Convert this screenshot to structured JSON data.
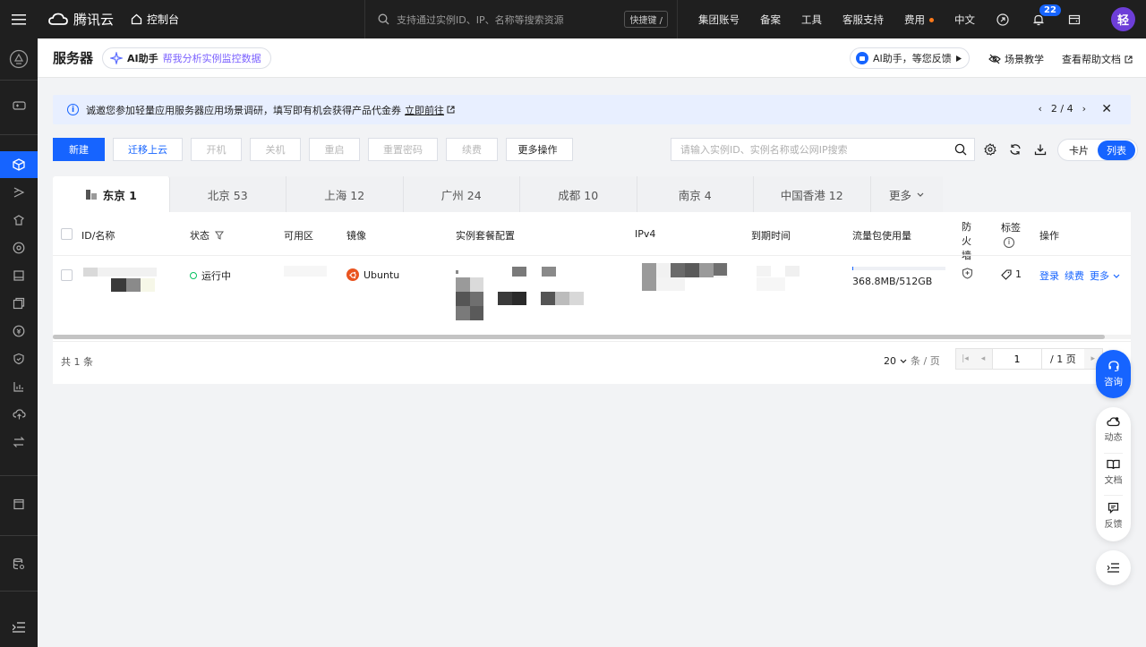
{
  "topbar": {
    "brand": "腾讯云",
    "console": "控制台",
    "search_placeholder": "支持通过实例ID、IP、名称等搜索资源",
    "shortcut": "快捷键 /",
    "links": [
      "集团账号",
      "备案",
      "工具",
      "客服支持",
      "费用",
      "中文"
    ],
    "notification_count": "22",
    "avatar_initial": "轻"
  },
  "header": {
    "title": "服务器",
    "ai_name": "AI助手",
    "ai_tip": "帮我分析实例监控数据",
    "ai_feedback": "AI助手，等您反馈",
    "scene_teaching": "场景教学",
    "help_docs": "查看帮助文档"
  },
  "notice": {
    "text": "诚邀您参加轻量应用服务器应用场景调研，填写即有机会获得产品代金券",
    "link": "立即前往",
    "pager": "2 / 4"
  },
  "toolbar": {
    "buttons": [
      "新建",
      "迁移上云",
      "开机",
      "关机",
      "重启",
      "重置密码",
      "续费"
    ],
    "more_ops": "更多操作",
    "search_placeholder": "请输入实例ID、实例名称或公网IP搜索",
    "view_card": "卡片",
    "view_list": "列表"
  },
  "regions": [
    {
      "label": "东京 1"
    },
    {
      "label": "北京 53"
    },
    {
      "label": "上海 12"
    },
    {
      "label": "广州 24"
    },
    {
      "label": "成都 10"
    },
    {
      "label": "南京 4"
    },
    {
      "label": "中国香港 12"
    },
    {
      "label": "更多"
    }
  ],
  "table": {
    "columns": [
      "ID/名称",
      "状态",
      "可用区",
      "镜像",
      "实例套餐配置",
      "IPv4",
      "到期时间",
      "流量包使用量",
      "防火墙",
      "标签",
      "操作"
    ],
    "row": {
      "status": "运行中",
      "image": "Ubuntu",
      "traffic": "368.8MB/512GB",
      "tag_count": "1",
      "actions": [
        "登录",
        "续费",
        "更多"
      ]
    },
    "total": "共 1 条",
    "page_size": "20",
    "page_size_unit": "条 / 页",
    "page_current": "1",
    "page_total": "/ 1 页"
  },
  "widgets": {
    "consult": "咨询",
    "dynamic": "动态",
    "docs": "文档",
    "feedback": "反馈"
  },
  "colors": {
    "primary": "#1664ff",
    "topbar_bg": "#1f1f1f",
    "running": "#07c160"
  }
}
